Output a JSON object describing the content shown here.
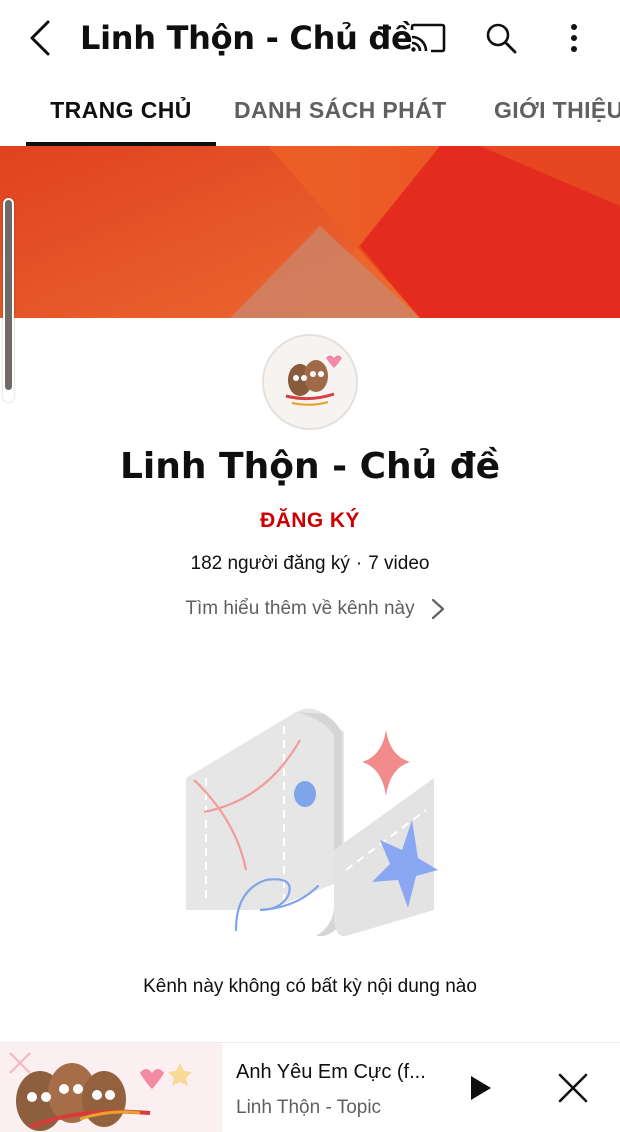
{
  "topbar": {
    "title": "Linh Thộn - Chủ đề",
    "back_icon": "chevron-left-icon",
    "cast_icon": "cast-icon",
    "search_icon": "search-icon",
    "more_icon": "more-vertical-icon"
  },
  "tabs": [
    {
      "label": "TRANG CHỦ",
      "active": true
    },
    {
      "label": "DANH SÁCH PHÁT",
      "active": false
    },
    {
      "label": "GIỚI THIỆU",
      "active": false
    }
  ],
  "channel": {
    "name": "Linh Thộn - Chủ đề",
    "subscribe_label": "ĐĂNG KÝ",
    "subscribers": "182 người đăng ký",
    "separator": "·",
    "video_count": "7 video",
    "about_link": "Tìm hiểu thêm về kênh này"
  },
  "empty_state": {
    "message": "Kênh này không có bất kỳ nội dung nào"
  },
  "mini_player": {
    "title": "Anh Yêu Em Cực (f...",
    "artist": "Linh Thộn - Topic",
    "play_icon": "play-icon",
    "close_icon": "close-icon"
  },
  "colors": {
    "accent": "#cc0000",
    "banner_red": "#e52d20",
    "banner_orange": "#ee5a1e",
    "secondary_text": "#606060"
  }
}
